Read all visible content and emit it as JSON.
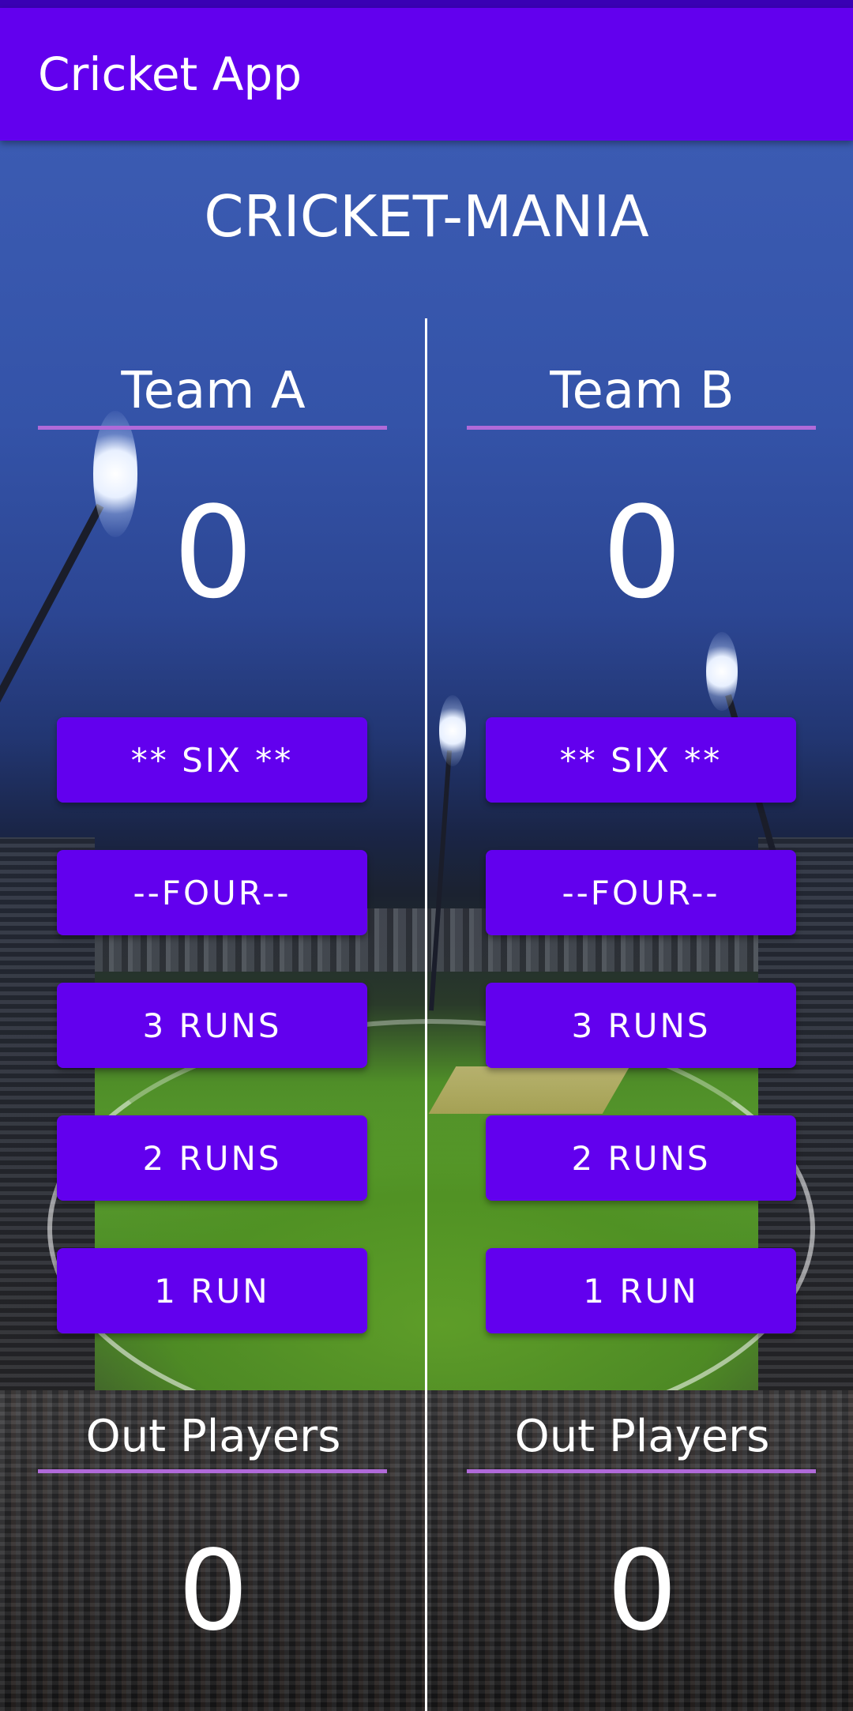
{
  "app_bar": {
    "title": "Cricket App",
    "color": "#6200ee"
  },
  "headline": "CRICKET-MANIA",
  "team_a": {
    "name": "Team A",
    "score": "0",
    "buttons": {
      "six": "** SIX **",
      "four": "--FOUR--",
      "three": "3 RUNS",
      "two": "2 RUNS",
      "one": "1 RUN"
    },
    "out_label": "Out Players",
    "out_count": "0"
  },
  "team_b": {
    "name": "Team B",
    "score": "0",
    "buttons": {
      "six": "** SIX **",
      "four": "--FOUR--",
      "three": "3 RUNS",
      "two": "2 RUNS",
      "one": "1 RUN"
    },
    "out_label": "Out Players",
    "out_count": "0"
  },
  "colors": {
    "accent": "#6200ee",
    "underline": "#b06ad9",
    "status_bar": "#3a00b4"
  }
}
